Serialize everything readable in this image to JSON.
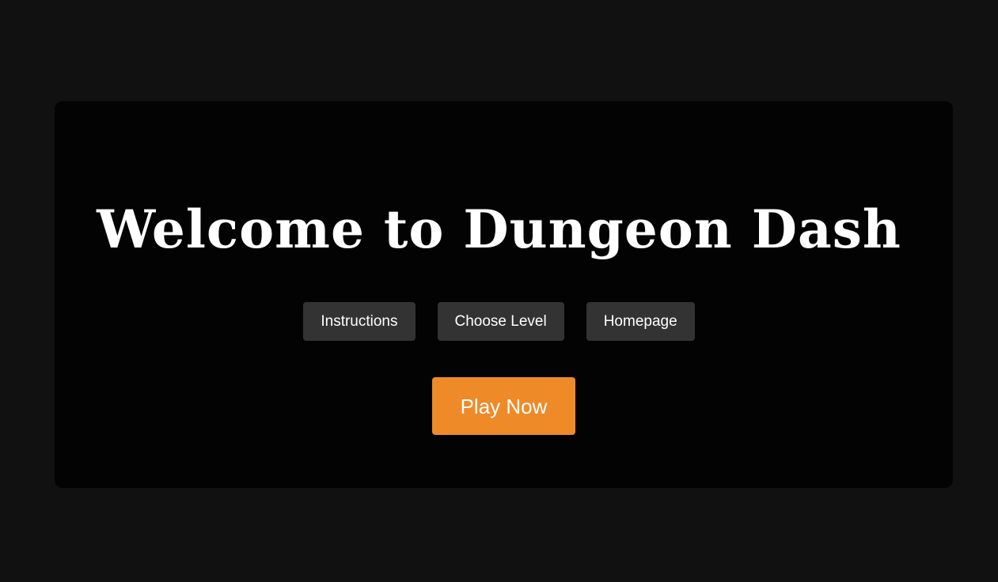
{
  "title": "Welcome to Dungeon Dash",
  "nav": {
    "instructions": "Instructions",
    "choose_level": "Choose Level",
    "homepage": "Homepage"
  },
  "play_button": "Play Now",
  "colors": {
    "page_background": "#111111",
    "panel_background": "#030303",
    "secondary_button": "#333333",
    "primary_button": "#ef8a28",
    "text": "#ffffff"
  }
}
